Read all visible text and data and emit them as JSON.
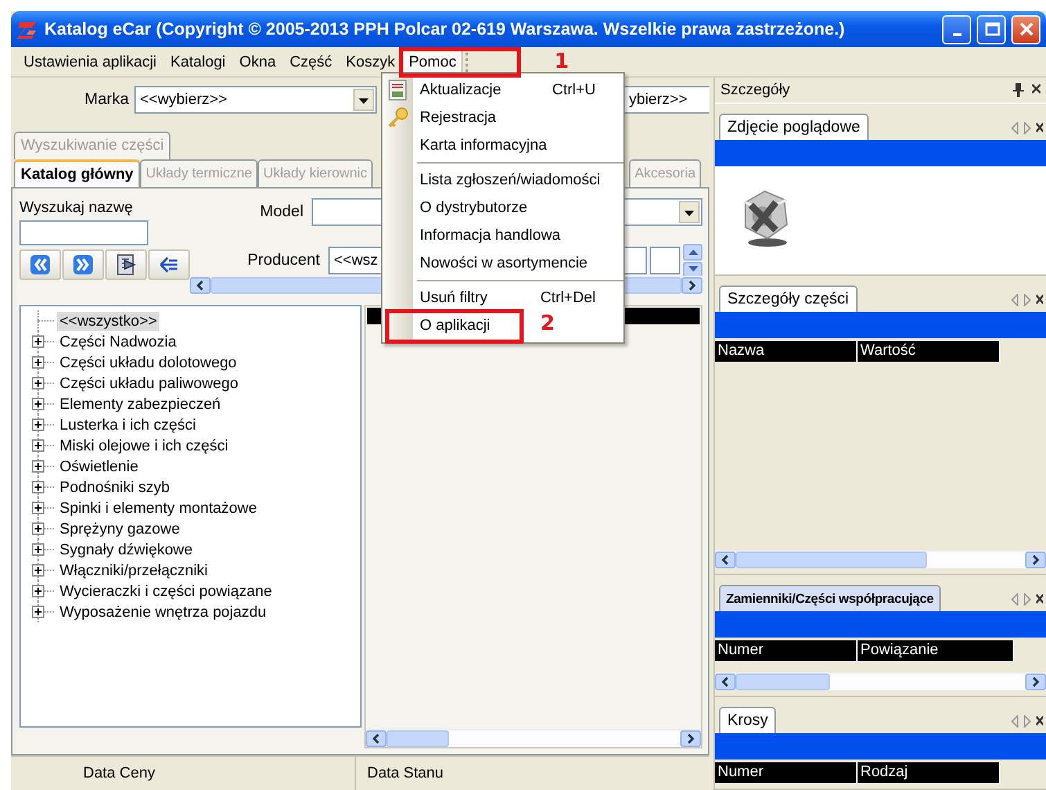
{
  "window": {
    "title": "Katalog eCar (Copyright © 2005-2013 PPH Polcar 02-619 Warszawa. Wszelkie prawa zastrzeżone.)"
  },
  "menu_bar": [
    {
      "label": "Ustawienia aplikacji",
      "selected": false
    },
    {
      "label": "Katalogi",
      "selected": false
    },
    {
      "label": "Okna",
      "selected": false
    },
    {
      "label": "Część",
      "selected": false
    },
    {
      "label": "Koszyk",
      "selected": false
    },
    {
      "label": "Pomoc",
      "selected": true,
      "callout": "1"
    }
  ],
  "open_menu": {
    "items": [
      {
        "kind": "item",
        "label": "Aktualizacje",
        "shortcut": "Ctrl+U"
      },
      {
        "kind": "item",
        "label": "Rejestracja"
      },
      {
        "kind": "item",
        "label": "Karta informacyjna"
      },
      {
        "kind": "separator"
      },
      {
        "kind": "item",
        "label": "Lista zgłoszeń/wiadomości"
      },
      {
        "kind": "item",
        "label": "O dystrybutorze"
      },
      {
        "kind": "item",
        "label": "Informacja handlowa"
      },
      {
        "kind": "item",
        "label": "Nowości w asortymencie"
      },
      {
        "kind": "separator"
      },
      {
        "kind": "item",
        "label": "Usuń filtry",
        "shortcut": "Ctrl+Del"
      },
      {
        "kind": "item",
        "label": "O aplikacji",
        "callout": "2"
      }
    ]
  },
  "marka": {
    "label": "Marka",
    "value": "<<wybierz>>"
  },
  "second_filter": {
    "value": "ybierz>>"
  },
  "search_group_tab": {
    "label": "Wyszukiwanie części"
  },
  "catalog_tabs": [
    {
      "label": "Katalog główny",
      "selected": true
    },
    {
      "label": "Układy termiczne",
      "selected": false
    },
    {
      "label": "Układy kierownic",
      "selected": false
    },
    {
      "label": "Akcesoria",
      "selected": false
    }
  ],
  "name_search": {
    "label": "Wyszukaj nazwę"
  },
  "model": {
    "label": "Model"
  },
  "producent": {
    "label": "Producent",
    "value": "<<wsz"
  },
  "tree": [
    {
      "kind": "leaf",
      "label": "<<wszystko>>",
      "selected": true
    },
    {
      "kind": "group",
      "label": "Części Nadwozia",
      "selected": false,
      "expanded": false
    },
    {
      "kind": "group",
      "label": "Części układu dolotowego",
      "selected": false,
      "expanded": false
    },
    {
      "kind": "group",
      "label": "Części układu paliwowego",
      "selected": false,
      "expanded": false
    },
    {
      "kind": "group",
      "label": "Elementy zabezpieczeń",
      "selected": false,
      "expanded": false
    },
    {
      "kind": "group",
      "label": "Lusterka i ich części",
      "selected": false,
      "expanded": false
    },
    {
      "kind": "group",
      "label": "Miski olejowe i ich części",
      "selected": false,
      "expanded": false
    },
    {
      "kind": "group",
      "label": "Oświetlenie",
      "selected": false,
      "expanded": false
    },
    {
      "kind": "group",
      "label": "Podnośniki szyb",
      "selected": false,
      "expanded": false
    },
    {
      "kind": "group",
      "label": "Spinki i elementy montażowe",
      "selected": false,
      "expanded": false
    },
    {
      "kind": "group",
      "label": "Sprężyny gazowe",
      "selected": false,
      "expanded": false
    },
    {
      "kind": "group",
      "label": "Sygnały dźwiękowe",
      "selected": false,
      "expanded": false
    },
    {
      "kind": "group",
      "label": "Włączniki/przełączniki",
      "selected": false,
      "expanded": false
    },
    {
      "kind": "group",
      "label": "Wycieraczki i części powiązane",
      "selected": false,
      "expanded": false
    },
    {
      "kind": "group",
      "label": "Wyposażenie wnętrza pojazdu",
      "selected": false,
      "expanded": false
    }
  ],
  "status_bar": [
    "Data Ceny",
    "Data Stanu"
  ],
  "details": {
    "title": "Szczegóły",
    "sections": [
      {
        "kind": "image",
        "tab": "Zdjęcie poglądowe",
        "selected": false
      },
      {
        "kind": "grid",
        "tab": "Szczegóły części",
        "selected": false,
        "columns": [
          "Nazwa",
          "Wartość"
        ]
      },
      {
        "kind": "grid",
        "tab": "Zamienniki/Części współpracujące",
        "selected": true,
        "columns": [
          "Numer",
          "Powiązanie"
        ]
      },
      {
        "kind": "grid",
        "tab": "Krosy",
        "selected": false,
        "columns": [
          "Numer",
          "Rodzaj"
        ]
      }
    ]
  }
}
